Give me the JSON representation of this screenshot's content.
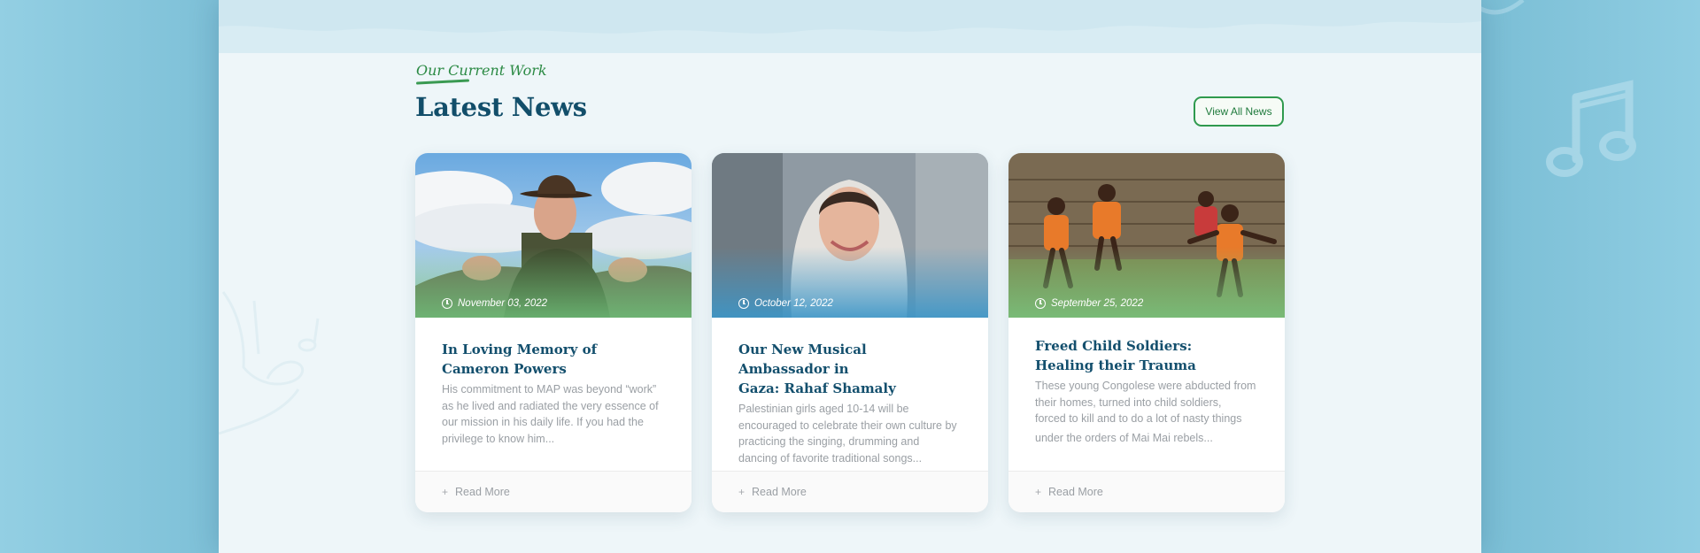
{
  "section": {
    "eyebrow": "Our Current Work",
    "title": "Latest News",
    "view_all_label": "View All News"
  },
  "cards": [
    {
      "date": "November 03, 2022",
      "title_lines": [
        "In Loving Memory of",
        "Cameron Powers"
      ],
      "excerpt_lines": [
        "His commitment to MAP was beyond “work”",
        "as he lived and radiated the very essence of",
        "our mission in his daily life. If you had the",
        "privilege to know him..."
      ],
      "read_more": "Read More",
      "image_desc": "man-in-hat-photo"
    },
    {
      "date": "October 12, 2022",
      "title_lines": [
        "Our New Musical Ambassador in",
        "Gaza: Rahaf Shamaly"
      ],
      "excerpt_lines": [
        "Palestinian girls aged 10-14 will be",
        "encouraged to celebrate their own culture by",
        "practicing the singing, drumming and",
        "dancing of favorite traditional songs..."
      ],
      "read_more": "Read More",
      "image_desc": "woman-in-headscarf-photo"
    },
    {
      "date": "September 25, 2022",
      "title_lines": [
        "Freed Child Soldiers:",
        "Healing their Trauma"
      ],
      "excerpt_lines": [
        "These young Congolese were abducted from",
        "their homes, turned into child soldiers,",
        "forced to kill and to do a lot of nasty things",
        "under the orders of Mai Mai rebels..."
      ],
      "read_more": "Read More",
      "image_desc": "children-dancing-photo"
    }
  ],
  "colors": {
    "accent_green": "#2f9a4e",
    "title_blue": "#124e6a",
    "panel_bg": "#eef6f9",
    "outer_bg": "#8ecbe0"
  }
}
